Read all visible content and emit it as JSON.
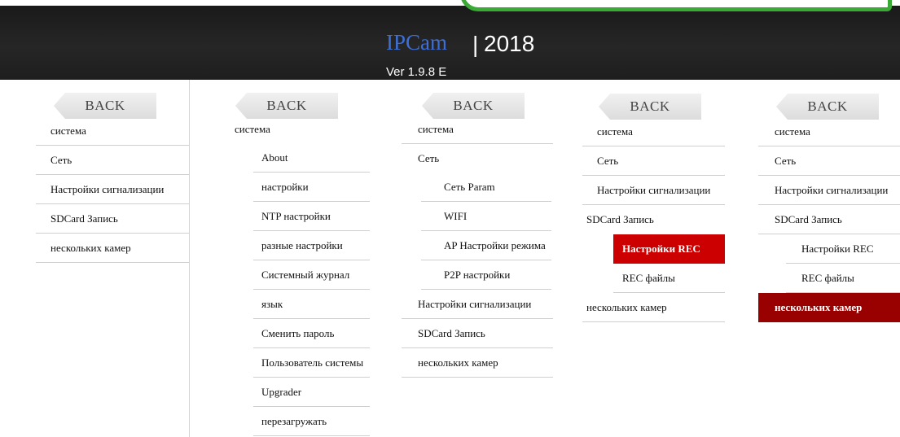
{
  "header": {
    "brand": "IPCam",
    "separator": "|",
    "year": "2018",
    "version": "Ver  1.9.8 E",
    "colors": {
      "background": "#222222",
      "brand": "#3d6fd6",
      "text": "#ffffff",
      "badge_border": "#3aa935"
    }
  },
  "back_label": "BACK",
  "panels": [
    {
      "id": "panel-1",
      "items": [
        "система",
        "Сеть",
        "Настройки сигнализации",
        "SDCard Запись",
        "нескольких камер"
      ]
    },
    {
      "id": "panel-2",
      "items": [
        "система",
        "About",
        "настройки",
        "NTP настройки",
        "разные настройки",
        "Системный журнал",
        "язык",
        "Сменить пароль",
        "Пользователь системы",
        "Upgrader",
        "перезагружать"
      ]
    },
    {
      "id": "panel-3",
      "items": [
        "система",
        "Сеть",
        "Сеть Param",
        "WIFI",
        "AP Настройки режима",
        "P2P настройки",
        "Настройки сигнализации",
        "SDCard Запись",
        "нескольких камер"
      ]
    },
    {
      "id": "panel-4",
      "items": [
        "система",
        "Сеть",
        "Настройки сигнализации",
        "SDCard Запись",
        "Настройки REC",
        "REC файлы",
        "нескольких камер"
      ],
      "active": "Настройки REC",
      "active_color": "#cc0000"
    },
    {
      "id": "panel-5",
      "items": [
        "система",
        "Сеть",
        "Настройки сигнализации",
        "SDCard Запись",
        "Настройки REC",
        "REC файлы",
        "нескольких камер"
      ],
      "active": "нескольких камер",
      "active_color": "#990000"
    }
  ]
}
